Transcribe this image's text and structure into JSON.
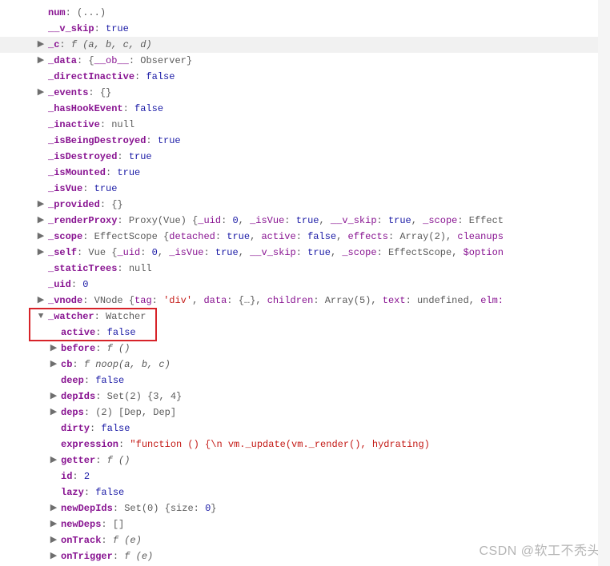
{
  "glyph": {
    "right": "▶",
    "down": "▼"
  },
  "punct": {
    "colon": ": ",
    "ellipsis": "(...)",
    "obj": "{}",
    "arr": "[]"
  },
  "rows": {
    "num": {
      "key": "num",
      "val": "(...)"
    },
    "vskip": {
      "key": "__v_skip",
      "val": "true"
    },
    "c": {
      "key": "_c",
      "sig": "f (a, b, c, d)"
    },
    "data": {
      "key": "_data",
      "pre": "{",
      "k1": "__ob__",
      "v1": "Observer",
      "post": "}"
    },
    "directInactive": {
      "key": "_directInactive",
      "val": "false"
    },
    "events": {
      "key": "_events",
      "val": "{}"
    },
    "hasHook": {
      "key": "_hasHookEvent",
      "val": "false"
    },
    "inactive": {
      "key": "_inactive",
      "val": "null"
    },
    "isBeingDestroyed": {
      "key": "_isBeingDestroyed",
      "val": "true"
    },
    "isDestroyed": {
      "key": "_isDestroyed",
      "val": "true"
    },
    "isMounted": {
      "key": "_isMounted",
      "val": "true"
    },
    "isVue": {
      "key": "_isVue",
      "val": "true"
    },
    "provided": {
      "key": "_provided",
      "val": "{}"
    },
    "renderProxy": {
      "key": "_renderProxy",
      "cls": "Proxy(Vue) {",
      "k1": "_uid",
      "v1": "0",
      "k2": "_isVue",
      "v2": "true",
      "k3": "__v_skip",
      "v3": "true",
      "k4": "_scope",
      "v4": "Effect"
    },
    "scope": {
      "key": "_scope",
      "cls": "EffectScope {",
      "k1": "detached",
      "v1": "true",
      "k2": "active",
      "v2": "false",
      "k3": "effects",
      "v3": "Array(2)",
      "k4": "cleanups"
    },
    "self": {
      "key": "_self",
      "cls": "Vue {",
      "k1": "_uid",
      "v1": "0",
      "k2": "_isVue",
      "v2": "true",
      "k3": "__v_skip",
      "v3": "true",
      "k4": "_scope",
      "v4": "EffectScope",
      "k5": "$option"
    },
    "staticTrees": {
      "key": "_staticTrees",
      "val": "null"
    },
    "uid": {
      "key": "_uid",
      "val": "0"
    },
    "vnode": {
      "key": "_vnode",
      "cls": "VNode {",
      "k1": "tag",
      "v1": "'div'",
      "k2": "data",
      "v2": "{…}",
      "k3": "children",
      "v3": "Array(5)",
      "k4": "text",
      "v4": "undefined",
      "k5": "elm:"
    },
    "watcher": {
      "key": "_watcher",
      "val": "Watcher"
    },
    "active": {
      "key": "active",
      "val": "false"
    },
    "before": {
      "key": "before",
      "sig": "f ()"
    },
    "cb": {
      "key": "cb",
      "sig": "f noop(a, b, c)"
    },
    "deep": {
      "key": "deep",
      "val": "false"
    },
    "depIds": {
      "key": "depIds",
      "cls": "Set(2) ",
      "body": "{3, 4}"
    },
    "deps": {
      "key": "deps",
      "count": "(2) ",
      "body": "[Dep, Dep]"
    },
    "dirty": {
      "key": "dirty",
      "val": "false"
    },
    "expression": {
      "key": "expression",
      "str": "\"function () {\\n            vm._update(vm._render(), hydrating)"
    },
    "getter": {
      "key": "getter",
      "sig": "f ()"
    },
    "id": {
      "key": "id",
      "val": "2"
    },
    "lazy": {
      "key": "lazy",
      "val": "false"
    },
    "newDepIds": {
      "key": "newDepIds",
      "cls": "Set(0) ",
      "body": "{size: ",
      "v": "0",
      "post": "}"
    },
    "newDeps": {
      "key": "newDeps",
      "val": "[]"
    },
    "onTrack": {
      "key": "onTrack",
      "sig": "f (e)"
    },
    "onTrigger": {
      "key": "onTrigger",
      "sig": "f (e)"
    }
  },
  "watermark": "CSDN @软工不秃头"
}
